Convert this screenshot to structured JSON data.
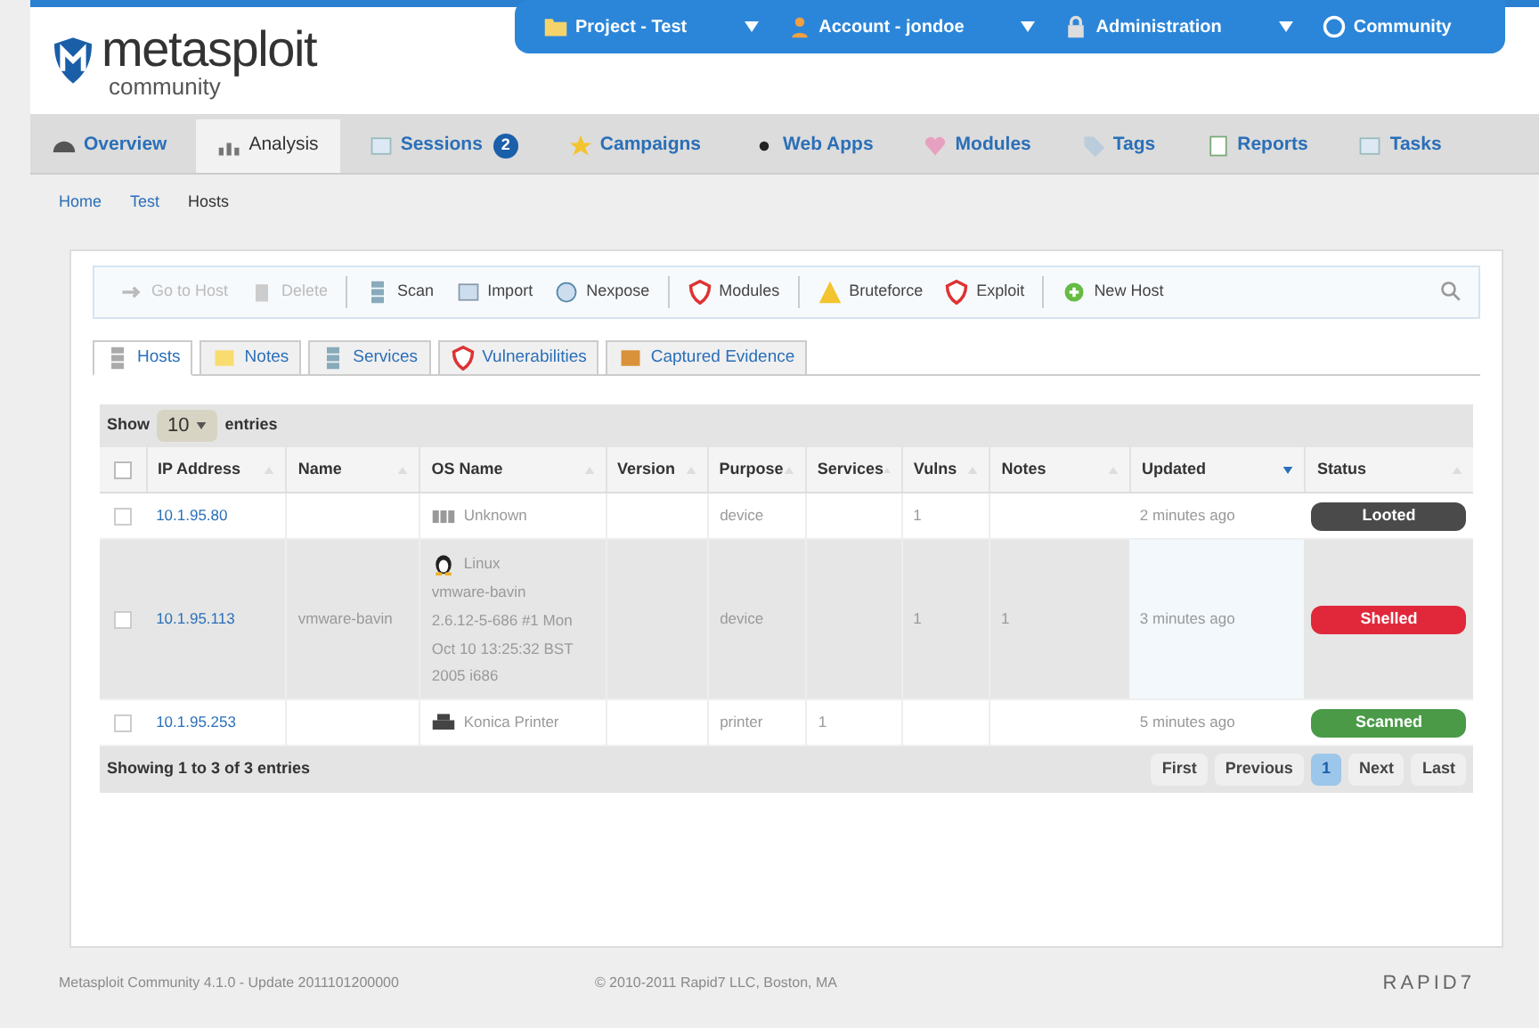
{
  "logo": {
    "name": "metasploit",
    "edition": "community"
  },
  "top_menu": [
    {
      "label": "Project - Test",
      "kind": "folder"
    },
    {
      "label": "Account - jondoe",
      "kind": "person"
    },
    {
      "label": "Administration",
      "kind": "lock"
    },
    {
      "label": "Community",
      "kind": "help"
    }
  ],
  "nav_tabs": [
    {
      "label": "Overview",
      "selected": false,
      "kind": "dashboard"
    },
    {
      "label": "Analysis",
      "selected": true,
      "kind": "analysis"
    },
    {
      "label": "Sessions",
      "selected": false,
      "kind": "window",
      "badge": "2"
    },
    {
      "label": "Campaigns",
      "selected": false,
      "kind": "star"
    },
    {
      "label": "Web Apps",
      "selected": false,
      "kind": "dot"
    },
    {
      "label": "Modules",
      "selected": false,
      "kind": "module"
    },
    {
      "label": "Tags",
      "selected": false,
      "kind": "tag"
    },
    {
      "label": "Reports",
      "selected": false,
      "kind": "report"
    },
    {
      "label": "Tasks",
      "selected": false,
      "kind": "window"
    }
  ],
  "breadcrumb": [
    {
      "label": "Home",
      "link": true
    },
    {
      "label": "Test",
      "link": true
    },
    {
      "label": "Hosts",
      "link": false
    }
  ],
  "toolbar": [
    {
      "label": "Go to Host",
      "disabled": true,
      "kind": "arrow"
    },
    {
      "label": "Delete",
      "disabled": true,
      "kind": "trash"
    },
    {
      "label": "Scan",
      "disabled": false,
      "kind": "scan"
    },
    {
      "label": "Import",
      "disabled": false,
      "kind": "import"
    },
    {
      "label": "Nexpose",
      "disabled": false,
      "kind": "nexpose"
    },
    {
      "label": "Modules",
      "disabled": false,
      "kind": "shield"
    },
    {
      "label": "Bruteforce",
      "disabled": false,
      "kind": "warning"
    },
    {
      "label": "Exploit",
      "disabled": false,
      "kind": "shield"
    },
    {
      "label": "New Host",
      "disabled": false,
      "kind": "plus"
    }
  ],
  "sub_tabs": [
    {
      "label": "Hosts",
      "selected": true,
      "kind": "server"
    },
    {
      "label": "Notes",
      "selected": false,
      "kind": "note"
    },
    {
      "label": "Services",
      "selected": false,
      "kind": "scan"
    },
    {
      "label": "Vulnerabilities",
      "selected": false,
      "kind": "shield"
    },
    {
      "label": "Captured Evidence",
      "selected": false,
      "kind": "evidence"
    }
  ],
  "length_menu": {
    "before": "Show",
    "value": "10",
    "after": "entries"
  },
  "table": {
    "all_checked": false,
    "columns": [
      {
        "label": "IP Address",
        "sorted": false
      },
      {
        "label": "Name",
        "sorted": false
      },
      {
        "label": "OS Name",
        "sorted": false
      },
      {
        "label": "Version",
        "sorted": false
      },
      {
        "label": "Purpose",
        "sorted": false
      },
      {
        "label": "Services",
        "sorted": false
      },
      {
        "label": "Vulns",
        "sorted": false
      },
      {
        "label": "Notes",
        "sorted": false
      },
      {
        "label": "Updated",
        "sorted": true
      },
      {
        "label": "Status",
        "sorted": false
      }
    ],
    "rows": [
      {
        "selected": false,
        "checked": false,
        "ip": "10.1.95.80",
        "name": "",
        "os": {
          "kind": "unknown",
          "lines": [
            "Unknown"
          ]
        },
        "version": "",
        "purpose": "device",
        "services": "",
        "vulns": "1",
        "notes": "",
        "updated": "2 minutes ago",
        "status": {
          "label": "Looted",
          "kind": "looted"
        }
      },
      {
        "selected": true,
        "checked": false,
        "ip": "10.1.95.113",
        "name": "vmware-bavin",
        "os": {
          "kind": "linux",
          "lines": [
            "Linux",
            "vmware-bavin",
            "2.6.12-5-686 #1 Mon",
            "Oct 10 13:25:32 BST",
            "2005 i686"
          ]
        },
        "version": "",
        "purpose": "device",
        "services": "",
        "vulns": "1",
        "notes": "1",
        "updated": "3 minutes ago",
        "status": {
          "label": "Shelled",
          "kind": "shelled"
        }
      },
      {
        "selected": false,
        "checked": false,
        "ip": "10.1.95.253",
        "name": "",
        "os": {
          "kind": "printer",
          "lines": [
            "Konica Printer"
          ]
        },
        "version": "",
        "purpose": "printer",
        "services": "1",
        "vulns": "",
        "notes": "",
        "updated": "5 minutes ago",
        "status": {
          "label": "Scanned",
          "kind": "scanned"
        }
      }
    ]
  },
  "info": "Showing 1 to 3 of 3 entries",
  "pagination": [
    {
      "label": "First",
      "selected": false
    },
    {
      "label": "Previous",
      "selected": false
    },
    {
      "label": "1",
      "selected": true
    },
    {
      "label": "Next",
      "selected": false
    },
    {
      "label": "Last",
      "selected": false
    }
  ],
  "footer": {
    "version": "Metasploit Community 4.1.0 - Update 2011101200000",
    "copyright": "© 2010-2011 Rapid7 LLC, Boston, MA",
    "brand": "RAPID7"
  }
}
